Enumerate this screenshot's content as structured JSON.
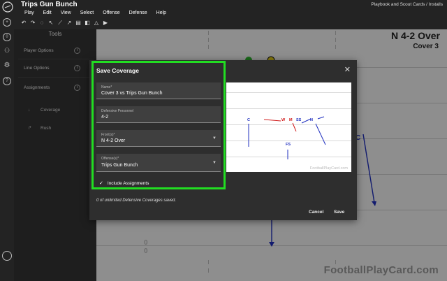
{
  "app": {
    "title": "Trips Gun Bunch",
    "menus": [
      "Play",
      "Edit",
      "View",
      "Select",
      "Offense",
      "Defense",
      "Help"
    ],
    "breadcrumb": "Playbook and Scout Cards  /  Installs",
    "toolbar_icons": [
      "undo-icon",
      "redo-icon",
      "lasso-icon",
      "pointer-icon",
      "line-icon",
      "route-icon",
      "note-icon",
      "mirror-horizontal-icon",
      "mirror-vertical-icon",
      "play-icon"
    ]
  },
  "tools": {
    "title": "Tools",
    "items": [
      {
        "label": "Player Options"
      },
      {
        "label": "Line Options"
      },
      {
        "label": "Assignments"
      }
    ],
    "assignments": [
      {
        "label": "Coverage"
      },
      {
        "label": "Rush"
      }
    ]
  },
  "field": {
    "formation_title": "N 4-2 Over",
    "coverage_title": "Cover 3",
    "watermark": "FootballPlayCard.com"
  },
  "modal": {
    "title": "Save Coverage",
    "name_label": "Name*",
    "name_value": "Cover 3 vs Trips Gun Bunch",
    "personnel_label": "Defensive Personnel",
    "personnel_value": "4-2",
    "front_label": "Front(s)*",
    "front_value": "N 4-2 Over",
    "offense_label": "Offense(s)*",
    "offense_value": "Trips Gun Bunch",
    "include_label": "Include Assignments",
    "saved_text": "0 of unlimited Defensive Coverages saved.",
    "cancel_label": "Cancel",
    "save_label": "Save",
    "preview_watermark": "FootballPlayCard.com",
    "preview_tags": [
      "C",
      "W",
      "M",
      "SS",
      "N",
      "FS"
    ]
  },
  "colors": {
    "highlight": "#22dd22",
    "defense_blue": "#1f2fbf",
    "defense_red": "#d11a1a"
  }
}
